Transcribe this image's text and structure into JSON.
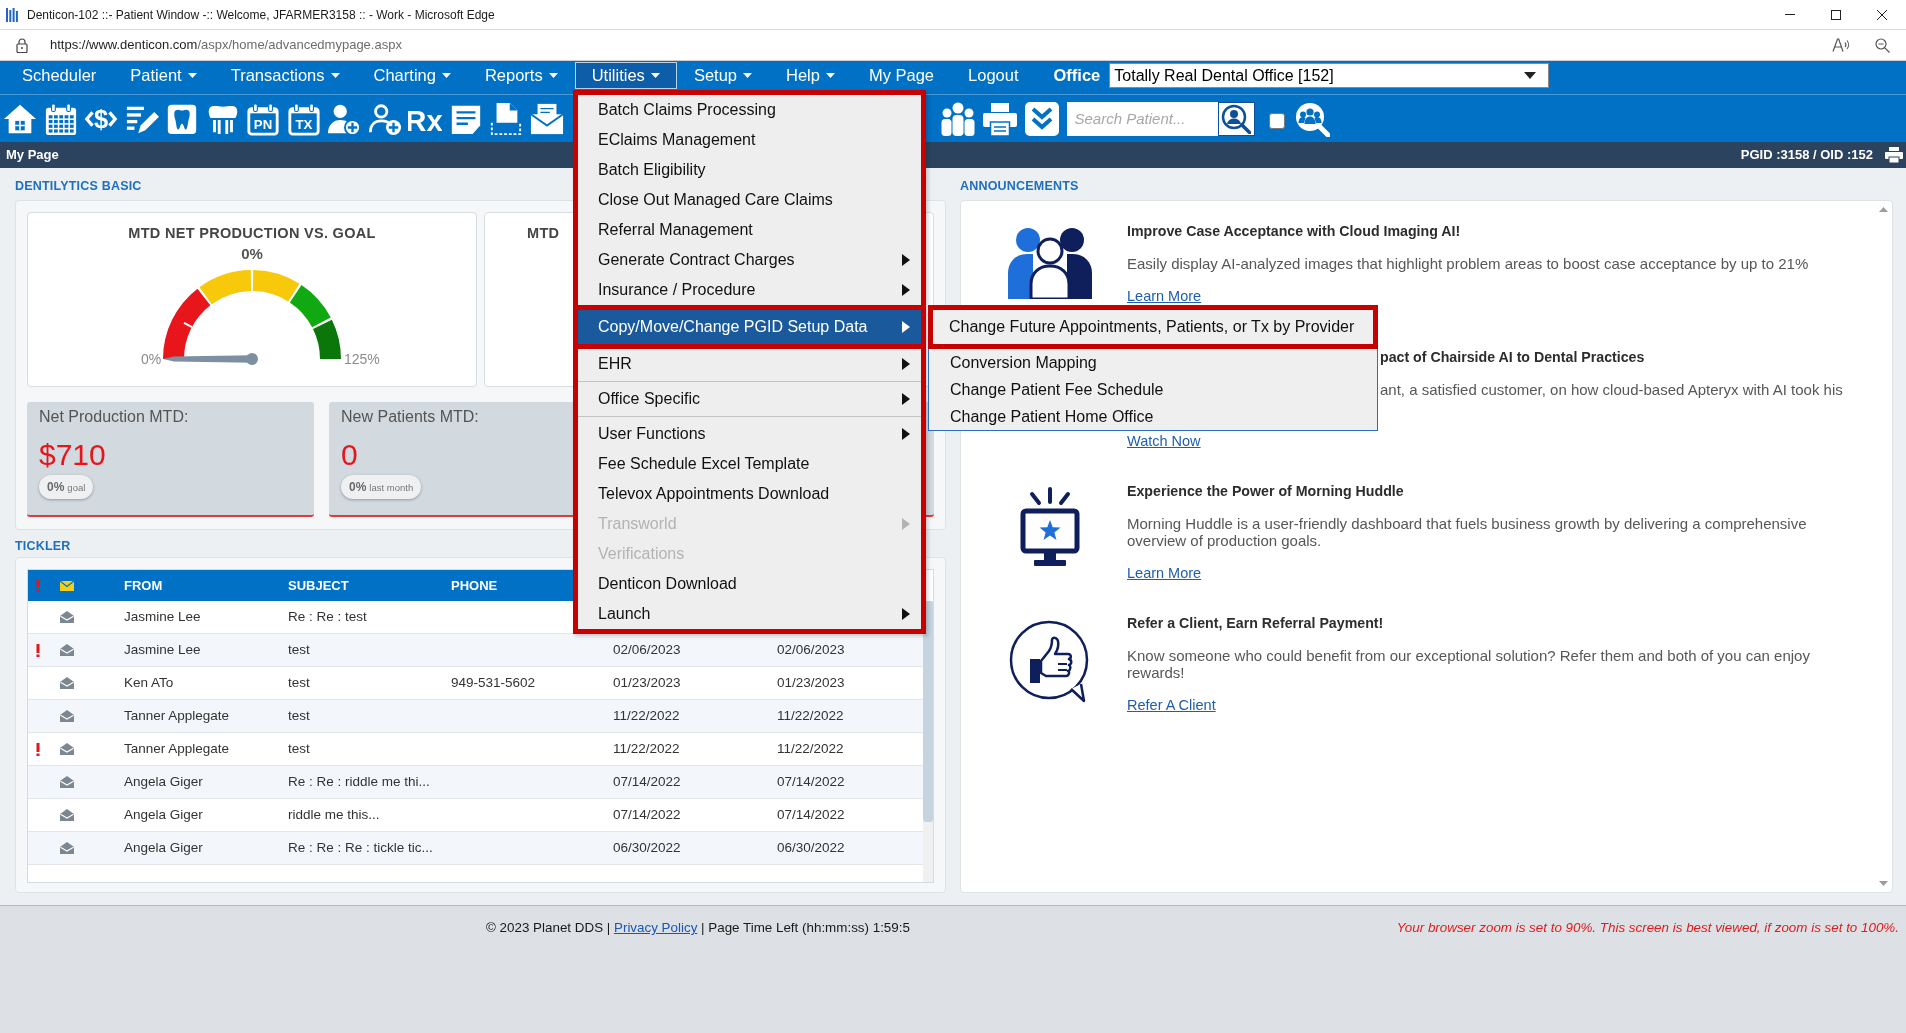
{
  "window": {
    "title": "Denticon-102 ::- Patient Window -:: Welcome, JFARMER3158 :: - Work - Microsoft Edge"
  },
  "address_bar": {
    "url_host": "https://www.denticon.com",
    "url_path": "/aspx/home/advancedmypage.aspx"
  },
  "menu_bar": {
    "items": [
      {
        "label": "Scheduler",
        "dropdown": false,
        "selected": false
      },
      {
        "label": "Patient",
        "dropdown": true,
        "selected": false
      },
      {
        "label": "Transactions",
        "dropdown": true,
        "selected": false
      },
      {
        "label": "Charting",
        "dropdown": true,
        "selected": false
      },
      {
        "label": "Reports",
        "dropdown": true,
        "selected": false
      },
      {
        "label": "Utilities",
        "dropdown": true,
        "selected": true,
        "menu": {
          "outlined": true,
          "items": [
            {
              "kind": "item",
              "label": "Batch Claims Processing",
              "submenu": false,
              "selected": false,
              "disabled": false,
              "outlined": false
            },
            {
              "kind": "item",
              "label": "EClaims Management",
              "submenu": false,
              "selected": false,
              "disabled": false,
              "outlined": false
            },
            {
              "kind": "item",
              "label": "Batch Eligibility",
              "submenu": false,
              "selected": false,
              "disabled": false,
              "outlined": false
            },
            {
              "kind": "item",
              "label": "Close Out Managed Care Claims",
              "submenu": false,
              "selected": false,
              "disabled": false,
              "outlined": false
            },
            {
              "kind": "item",
              "label": "Referral Management",
              "submenu": false,
              "selected": false,
              "disabled": false,
              "outlined": false
            },
            {
              "kind": "item",
              "label": "Generate Contract Charges",
              "submenu": true,
              "selected": false,
              "disabled": false,
              "outlined": false
            },
            {
              "kind": "item",
              "label": "Insurance / Procedure",
              "submenu": true,
              "selected": false,
              "disabled": false,
              "outlined": false
            },
            {
              "kind": "item",
              "label": "Copy/Move/Change PGID Setup Data",
              "submenu": true,
              "selected": true,
              "disabled": false,
              "outlined": true,
              "children": [
                {
                  "label": "Change Future Appointments, Patients, or Tx by Provider",
                  "selected": false,
                  "outlined": true
                },
                {
                  "label": "Conversion Mapping",
                  "selected": false,
                  "outlined": false
                },
                {
                  "label": "Change Patient Fee Schedule",
                  "selected": false,
                  "outlined": false
                },
                {
                  "label": "Change Patient Home Office",
                  "selected": false,
                  "outlined": false
                }
              ]
            },
            {
              "kind": "item",
              "label": "EHR",
              "submenu": true,
              "selected": false,
              "disabled": false,
              "outlined": false
            },
            {
              "kind": "separator"
            },
            {
              "kind": "item",
              "label": "Office Specific",
              "submenu": true,
              "selected": false,
              "disabled": false,
              "outlined": false
            },
            {
              "kind": "separator"
            },
            {
              "kind": "item",
              "label": "User Functions",
              "submenu": true,
              "selected": false,
              "disabled": false,
              "outlined": false
            },
            {
              "kind": "item",
              "label": "Fee Schedule Excel Template",
              "submenu": false,
              "selected": false,
              "disabled": false,
              "outlined": false
            },
            {
              "kind": "item",
              "label": "Televox Appointments Download",
              "submenu": false,
              "selected": false,
              "disabled": false,
              "outlined": false
            },
            {
              "kind": "item",
              "label": "Transworld",
              "submenu": true,
              "selected": false,
              "disabled": true,
              "outlined": false
            },
            {
              "kind": "item",
              "label": "Verifications",
              "submenu": false,
              "selected": false,
              "disabled": true,
              "outlined": false
            },
            {
              "kind": "item",
              "label": "Denticon Download",
              "submenu": false,
              "selected": false,
              "disabled": false,
              "outlined": false
            },
            {
              "kind": "item",
              "label": "Launch",
              "submenu": true,
              "selected": false,
              "disabled": false,
              "outlined": false
            }
          ]
        }
      },
      {
        "label": "Setup",
        "dropdown": true,
        "selected": false
      },
      {
        "label": "Help",
        "dropdown": true,
        "selected": false
      },
      {
        "label": "My Page",
        "dropdown": false,
        "selected": false
      },
      {
        "label": "Logout",
        "dropdown": false,
        "selected": false
      }
    ],
    "office_label": "Office",
    "office_value": "Totally Real Dental Office [152]"
  },
  "toolbar": {
    "tools": [
      {
        "kind": "home"
      },
      {
        "kind": "calendar"
      },
      {
        "kind": "money",
        "text": "$"
      },
      {
        "kind": "notes"
      },
      {
        "kind": "tooth"
      },
      {
        "kind": "teeth"
      },
      {
        "kind": "calendar-text",
        "text": "PN"
      },
      {
        "kind": "calendar-text",
        "text": "TX"
      },
      {
        "kind": "person-add"
      },
      {
        "kind": "person-add-outline"
      },
      {
        "kind": "prescription",
        "text": "Rx"
      },
      {
        "kind": "note"
      },
      {
        "kind": "scan"
      },
      {
        "kind": "mail"
      }
    ],
    "right_tools": [
      {
        "kind": "family"
      },
      {
        "kind": "printer"
      },
      {
        "kind": "chevrons"
      }
    ],
    "search": {
      "placeholder": "Search Patient..."
    },
    "option_checkbox": {
      "checked": false
    }
  },
  "page_bar": {
    "title": "My Page",
    "ids": "PGID :3158 / OID :152"
  },
  "dentilytics": {
    "heading": "DENTILYTICS BASIC",
    "gauges": [
      {
        "title": "MTD NET PRODUCTION VS. GOAL",
        "value": "0%",
        "min_label": "0%",
        "max_label": "125%",
        "level": 0
      },
      {
        "title": "MTD"
      }
    ],
    "stats": [
      {
        "label": "Net Production MTD:",
        "value": "$710",
        "pill_value": "0%",
        "pill_caption": "goal"
      },
      {
        "label": "New Patients MTD:",
        "value": "0",
        "pill_value": "0%",
        "pill_caption": "last month"
      }
    ]
  },
  "tickler": {
    "heading": "TICKLER",
    "header": {
      "from": "FROM",
      "subject": "SUBJECT",
      "phone": "PHONE"
    },
    "rows": [
      {
        "flagged": false,
        "from": "Jasmine Lee",
        "subject": "Re : Re : test"
      },
      {
        "flagged": true,
        "from": "Jasmine Lee",
        "subject": "test",
        "column_6": "02/06/2023",
        "column_7": "02/06/2023"
      },
      {
        "flagged": false,
        "from": "Ken ATo",
        "subject": "test",
        "phone": "949-531-5602",
        "column_6": "01/23/2023",
        "column_7": "01/23/2023"
      },
      {
        "flagged": false,
        "from": "Tanner Applegate",
        "subject": "test",
        "column_6": "11/22/2022",
        "column_7": "11/22/2022"
      },
      {
        "flagged": true,
        "from": "Tanner Applegate",
        "subject": "test",
        "column_6": "11/22/2022",
        "column_7": "11/22/2022"
      },
      {
        "flagged": false,
        "from": "Angela Giger",
        "subject": "Re : Re : riddle me thi...",
        "column_6": "07/14/2022",
        "column_7": "07/14/2022"
      },
      {
        "flagged": false,
        "from": "Angela Giger",
        "subject": "riddle me this...",
        "column_6": "07/14/2022",
        "column_7": "07/14/2022"
      },
      {
        "flagged": false,
        "from": "Angela Giger",
        "subject": "Re : Re : Re : tickle tic...",
        "column_6": "06/30/2022",
        "column_7": "06/30/2022"
      }
    ]
  },
  "announcements": {
    "heading": "ANNOUNCEMENTS",
    "items": [
      {
        "kind": "people",
        "title": "Improve Case Acceptance with Cloud Imaging AI!",
        "text": "Easily display AI-analyzed images that highlight problem areas to boost case acceptance by up to 21%",
        "link": "Learn More"
      },
      {
        "kind": "plain",
        "title": "pact of Chairside AI to Dental Practices",
        "text": "ant, a satisfied customer, on how cloud-based Apteryx with AI took his",
        "link": "Watch Now"
      },
      {
        "kind": "monitor",
        "title": "Experience the Power of Morning Huddle",
        "text": "Morning Huddle is a user-friendly dashboard that fuels business growth by delivering a comprehensive overview of production goals.",
        "link": "Learn More"
      },
      {
        "kind": "thumbs",
        "title": "Refer a Client, Earn Referral Payment!",
        "text": "Know someone who could benefit from our exceptional solution? Refer them and both of you can enjoy rewards!",
        "link": "Refer A Client"
      }
    ]
  },
  "footer": {
    "copyright": "© 2023 Planet DDS |",
    "privacy_link": "Privacy Policy",
    "session_timer": "| Page Time Left (hh:mm:ss) 1:59:5",
    "zoom_warning": "Your browser zoom is set to 90%. This screen is best viewed, if zoom is set to 100%."
  }
}
